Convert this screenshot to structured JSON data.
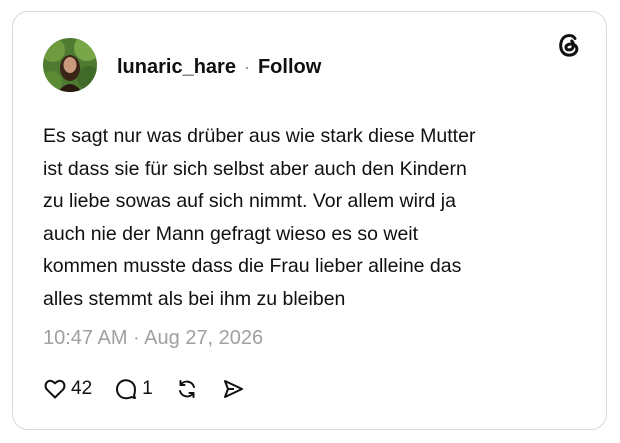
{
  "post": {
    "username": "lunaric_hare",
    "separator": "·",
    "follow_label": "Follow",
    "text": "Es sagt nur was drüber aus wie stark diese Mutter\nist dass sie für sich selbst aber auch den Kindern\nzu liebe sowas auf sich nimmt. Vor allem wird ja\nauch nie der Mann gefragt wieso es so weit\nkommen musste dass die Frau lieber alleine das\nalles stemmt als bei ihm zu bleiben",
    "timestamp": "10:47 AM · Aug 27, 2026"
  },
  "actions": {
    "like_count": "42",
    "reply_count": "1"
  },
  "icons": [
    "threads-logo-icon",
    "heart-icon",
    "comment-icon",
    "repost-icon",
    "share-icon"
  ],
  "colors": {
    "text": "#101010",
    "muted": "#a0a0a0",
    "border": "#d9d9d9"
  }
}
